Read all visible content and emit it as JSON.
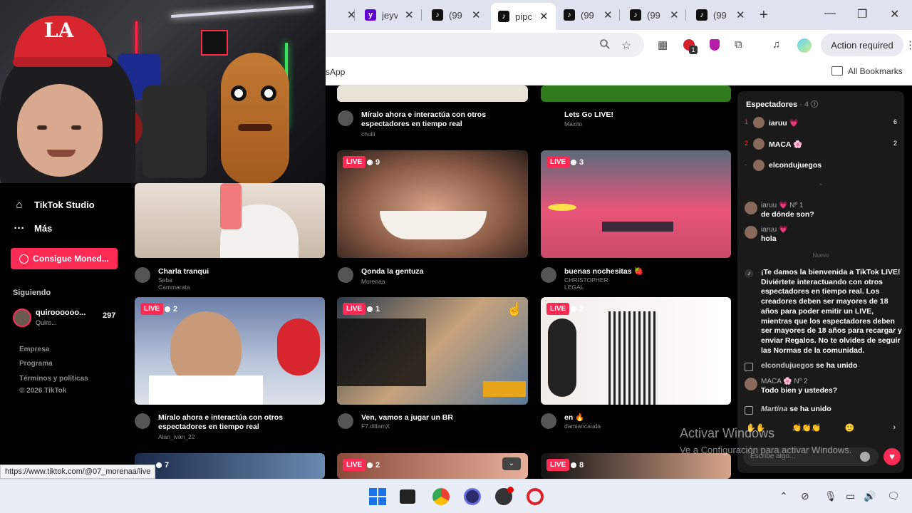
{
  "browser": {
    "tabs": [
      {
        "title": "",
        "close": "✕"
      },
      {
        "title": "jeyv",
        "icon": "yahoo-icon",
        "close": "✕"
      },
      {
        "title": "(99",
        "icon": "tiktok-icon",
        "close": "✕"
      },
      {
        "title": "pipc",
        "icon": "tiktok-icon",
        "close": "✕"
      },
      {
        "title": "(99",
        "icon": "tiktok-icon",
        "close": "✕"
      },
      {
        "title": "(99",
        "icon": "tiktok-icon",
        "close": "✕"
      },
      {
        "title": "(99",
        "icon": "tiktok-icon",
        "close": "✕"
      }
    ],
    "new_tab": "+",
    "minimize": "—",
    "restore": "❐",
    "close": "✕",
    "action_required": "Action required",
    "bookmarks_left": "sApp",
    "all_bookmarks": "All Bookmarks",
    "status_url": "https://www.tiktok.com/@07_morenaa/live"
  },
  "sidebar": {
    "items": [
      {
        "label": "TikTok Studio",
        "icon": "home-icon"
      },
      {
        "label": "Más",
        "icon": "more-icon"
      }
    ],
    "coins_button": "Consigue Moned...",
    "following_label": "Siguiendo",
    "following_user": {
      "name": "quiroooooo...",
      "sub": "Quiro...",
      "count": "297"
    },
    "footer": [
      "Empresa",
      "Programa",
      "Términos y políticas",
      "© 2026 TikTok"
    ]
  },
  "feed": {
    "top_row": [
      {
        "title": "Míralo ahora e interactúa con otros espectadores en tiempo real",
        "user": "chulii"
      },
      {
        "title": "Lets Go LIVE!",
        "user": "Maxito"
      }
    ],
    "cards": [
      {
        "live": "LIVE",
        "viewers": "",
        "title": "Charla tranqui",
        "user": "Seba Cammarata"
      },
      {
        "live": "LIVE",
        "viewers": "9",
        "title": "Qonda la gentuza",
        "user": "Morenaa"
      },
      {
        "live": "LIVE",
        "viewers": "3",
        "title": "buenas nochesitas 🍓",
        "user": "CHRISTOPHER LEGAL"
      },
      {
        "live": "LIVE",
        "viewers": "2",
        "title": "Míralo ahora e interactúa con otros espectadores en tiempo real",
        "user": "Alan_ivan_22"
      },
      {
        "live": "LIVE",
        "viewers": "1",
        "title": "Ven, vamos a jugar un BR",
        "user": "F7.dillamX"
      },
      {
        "live": "LIVE",
        "viewers": "2",
        "title": "en 🔥",
        "user": "damiancauda"
      },
      {
        "live": "",
        "viewers": "7",
        "title": "",
        "user": ""
      },
      {
        "live": "LIVE",
        "viewers": "2",
        "title": "",
        "user": ""
      },
      {
        "live": "LIVE",
        "viewers": "8",
        "title": "",
        "user": ""
      }
    ]
  },
  "chat": {
    "header": "Espectadores",
    "count": "· 4",
    "spectators": [
      {
        "rank": "1",
        "name": "iaruu 💗",
        "count": "6"
      },
      {
        "rank": "2",
        "name": "MACA 🌸",
        "count": "2"
      },
      {
        "rank": "-",
        "name": "elcondujuegos",
        "count": ""
      }
    ],
    "messages": [
      {
        "name": "iaruu 💗  Nº 1",
        "text": "de dónde son?"
      },
      {
        "name": "iaruu 💗",
        "text": "hola"
      }
    ],
    "nuevo": "Nuevo",
    "welcome": "¡Te damos la bienvenida a TikTok LIVE! Diviértete interactuando con otros espectadores en tiempo real. Los creadores deben ser mayores de 18 años para poder emitir un LIVE, mientras que los espectadores deben ser mayores de 18 años para recargar y enviar Regalos. No te olvides de seguir las Normas de la comunidad.",
    "joined1": {
      "name": "elcondujuegos",
      "text": "se ha unido"
    },
    "maca_msg": {
      "name": "MACA 🌸  Nº 2",
      "text": "Todo bien y ustedes?"
    },
    "joined2": {
      "name": "Martina",
      "text": "se ha unido"
    },
    "input_placeholder": "Escribe algo..."
  },
  "watermark": {
    "line1": "Activar Windows",
    "line2": "Ve a Configuración para activar Windows."
  },
  "webcam": {
    "cap_logo": "LA"
  }
}
